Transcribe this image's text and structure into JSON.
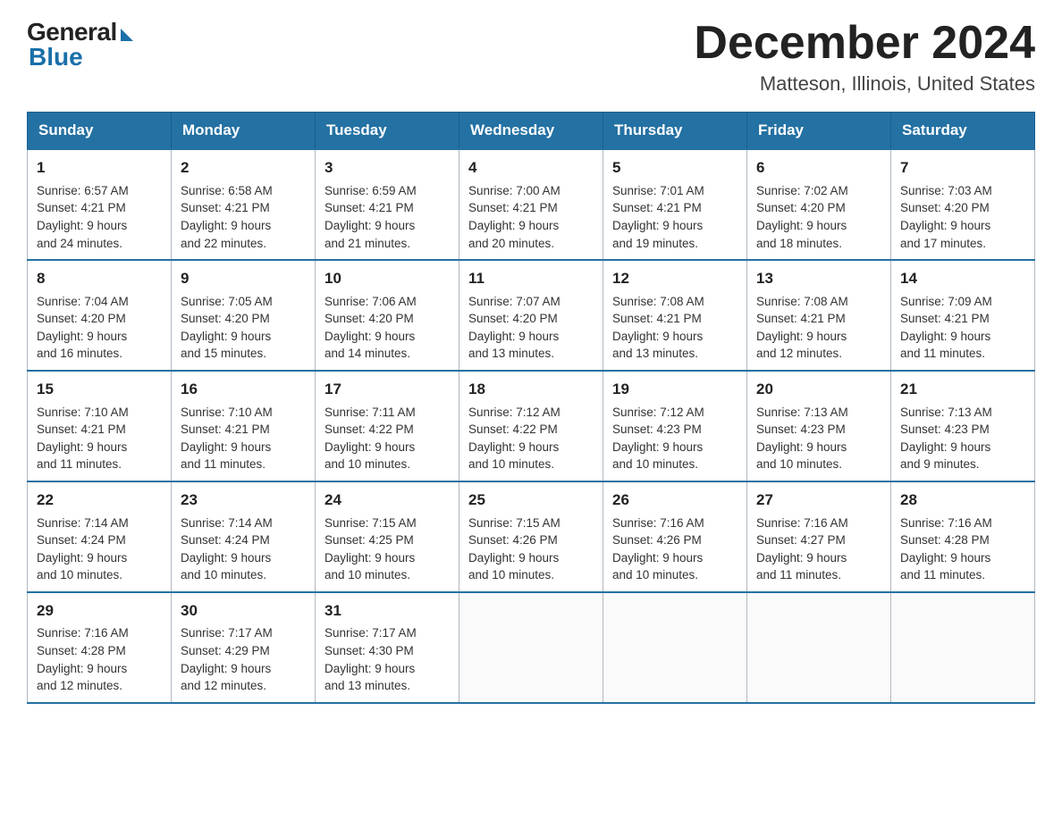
{
  "header": {
    "logo_general": "General",
    "logo_blue": "Blue",
    "month_title": "December 2024",
    "location": "Matteson, Illinois, United States"
  },
  "weekdays": [
    "Sunday",
    "Monday",
    "Tuesday",
    "Wednesday",
    "Thursday",
    "Friday",
    "Saturday"
  ],
  "weeks": [
    [
      {
        "day": "1",
        "sunrise": "6:57 AM",
        "sunset": "4:21 PM",
        "daylight": "9 hours and 24 minutes."
      },
      {
        "day": "2",
        "sunrise": "6:58 AM",
        "sunset": "4:21 PM",
        "daylight": "9 hours and 22 minutes."
      },
      {
        "day": "3",
        "sunrise": "6:59 AM",
        "sunset": "4:21 PM",
        "daylight": "9 hours and 21 minutes."
      },
      {
        "day": "4",
        "sunrise": "7:00 AM",
        "sunset": "4:21 PM",
        "daylight": "9 hours and 20 minutes."
      },
      {
        "day": "5",
        "sunrise": "7:01 AM",
        "sunset": "4:21 PM",
        "daylight": "9 hours and 19 minutes."
      },
      {
        "day": "6",
        "sunrise": "7:02 AM",
        "sunset": "4:20 PM",
        "daylight": "9 hours and 18 minutes."
      },
      {
        "day": "7",
        "sunrise": "7:03 AM",
        "sunset": "4:20 PM",
        "daylight": "9 hours and 17 minutes."
      }
    ],
    [
      {
        "day": "8",
        "sunrise": "7:04 AM",
        "sunset": "4:20 PM",
        "daylight": "9 hours and 16 minutes."
      },
      {
        "day": "9",
        "sunrise": "7:05 AM",
        "sunset": "4:20 PM",
        "daylight": "9 hours and 15 minutes."
      },
      {
        "day": "10",
        "sunrise": "7:06 AM",
        "sunset": "4:20 PM",
        "daylight": "9 hours and 14 minutes."
      },
      {
        "day": "11",
        "sunrise": "7:07 AM",
        "sunset": "4:20 PM",
        "daylight": "9 hours and 13 minutes."
      },
      {
        "day": "12",
        "sunrise": "7:08 AM",
        "sunset": "4:21 PM",
        "daylight": "9 hours and 13 minutes."
      },
      {
        "day": "13",
        "sunrise": "7:08 AM",
        "sunset": "4:21 PM",
        "daylight": "9 hours and 12 minutes."
      },
      {
        "day": "14",
        "sunrise": "7:09 AM",
        "sunset": "4:21 PM",
        "daylight": "9 hours and 11 minutes."
      }
    ],
    [
      {
        "day": "15",
        "sunrise": "7:10 AM",
        "sunset": "4:21 PM",
        "daylight": "9 hours and 11 minutes."
      },
      {
        "day": "16",
        "sunrise": "7:10 AM",
        "sunset": "4:21 PM",
        "daylight": "9 hours and 11 minutes."
      },
      {
        "day": "17",
        "sunrise": "7:11 AM",
        "sunset": "4:22 PM",
        "daylight": "9 hours and 10 minutes."
      },
      {
        "day": "18",
        "sunrise": "7:12 AM",
        "sunset": "4:22 PM",
        "daylight": "9 hours and 10 minutes."
      },
      {
        "day": "19",
        "sunrise": "7:12 AM",
        "sunset": "4:23 PM",
        "daylight": "9 hours and 10 minutes."
      },
      {
        "day": "20",
        "sunrise": "7:13 AM",
        "sunset": "4:23 PM",
        "daylight": "9 hours and 10 minutes."
      },
      {
        "day": "21",
        "sunrise": "7:13 AM",
        "sunset": "4:23 PM",
        "daylight": "9 hours and 9 minutes."
      }
    ],
    [
      {
        "day": "22",
        "sunrise": "7:14 AM",
        "sunset": "4:24 PM",
        "daylight": "9 hours and 10 minutes."
      },
      {
        "day": "23",
        "sunrise": "7:14 AM",
        "sunset": "4:24 PM",
        "daylight": "9 hours and 10 minutes."
      },
      {
        "day": "24",
        "sunrise": "7:15 AM",
        "sunset": "4:25 PM",
        "daylight": "9 hours and 10 minutes."
      },
      {
        "day": "25",
        "sunrise": "7:15 AM",
        "sunset": "4:26 PM",
        "daylight": "9 hours and 10 minutes."
      },
      {
        "day": "26",
        "sunrise": "7:16 AM",
        "sunset": "4:26 PM",
        "daylight": "9 hours and 10 minutes."
      },
      {
        "day": "27",
        "sunrise": "7:16 AM",
        "sunset": "4:27 PM",
        "daylight": "9 hours and 11 minutes."
      },
      {
        "day": "28",
        "sunrise": "7:16 AM",
        "sunset": "4:28 PM",
        "daylight": "9 hours and 11 minutes."
      }
    ],
    [
      {
        "day": "29",
        "sunrise": "7:16 AM",
        "sunset": "4:28 PM",
        "daylight": "9 hours and 12 minutes."
      },
      {
        "day": "30",
        "sunrise": "7:17 AM",
        "sunset": "4:29 PM",
        "daylight": "9 hours and 12 minutes."
      },
      {
        "day": "31",
        "sunrise": "7:17 AM",
        "sunset": "4:30 PM",
        "daylight": "9 hours and 13 minutes."
      },
      null,
      null,
      null,
      null
    ]
  ],
  "labels": {
    "sunrise": "Sunrise:",
    "sunset": "Sunset:",
    "daylight": "Daylight:"
  }
}
